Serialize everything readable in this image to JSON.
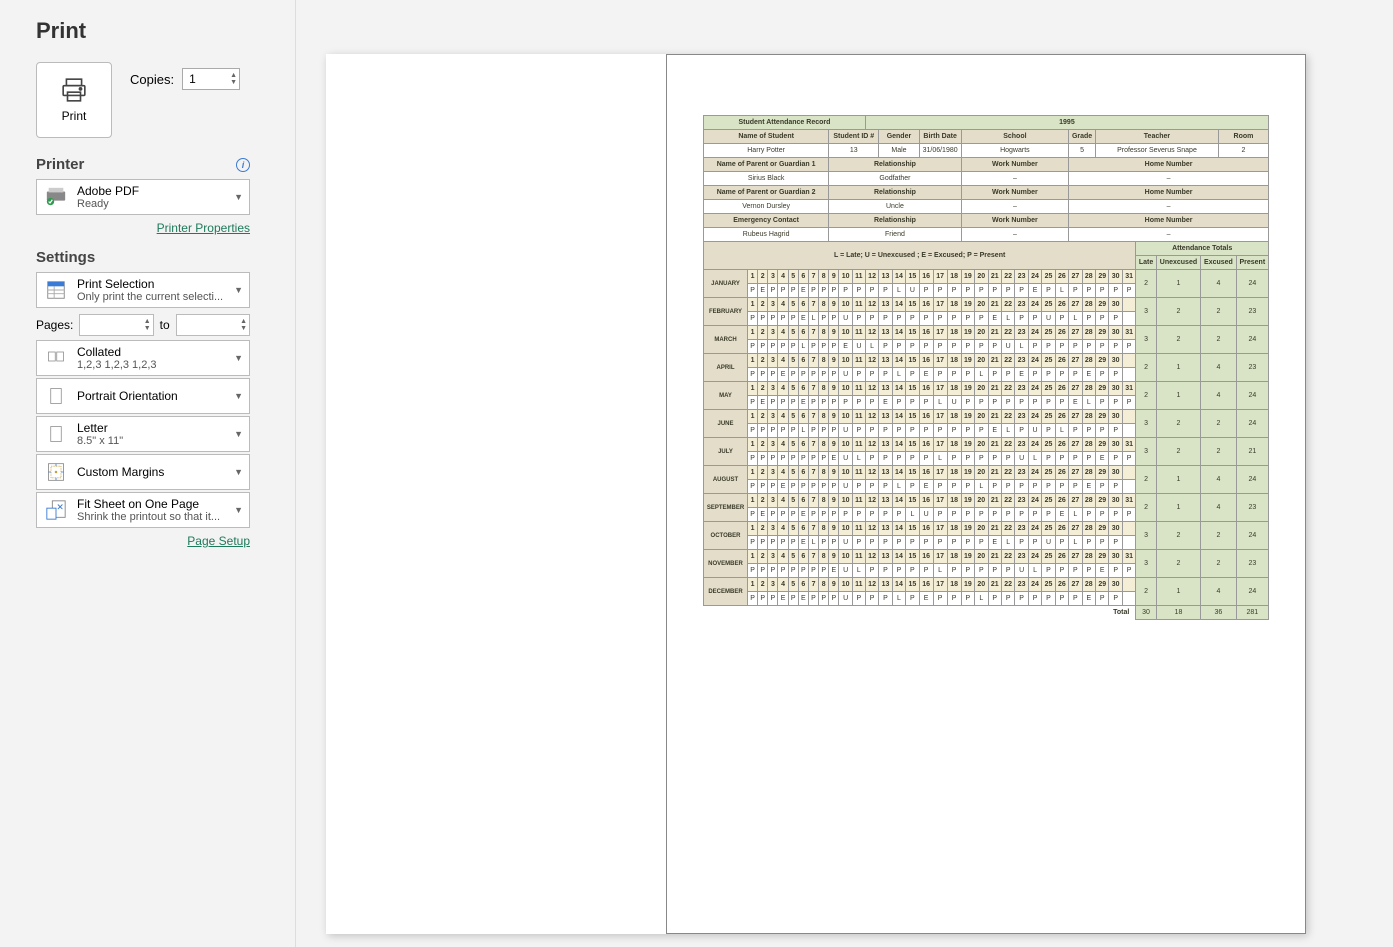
{
  "panel": {
    "title": "Print",
    "print_btn": "Print",
    "copies_label": "Copies:",
    "copies_value": "1",
    "printer_head": "Printer",
    "printer_name": "Adobe PDF",
    "printer_status": "Ready",
    "printer_props": "Printer Properties",
    "settings_head": "Settings",
    "scope_l1": "Print Selection",
    "scope_l2": "Only print the current selecti...",
    "pages_label": "Pages:",
    "to_label": "to",
    "collate_l1": "Collated",
    "collate_l2": "1,2,3    1,2,3    1,2,3",
    "orient": "Portrait Orientation",
    "paper_l1": "Letter",
    "paper_l2": "8.5\" x 11\"",
    "margins": "Custom Margins",
    "fit_l1": "Fit Sheet on One Page",
    "fit_l2": "Shrink the printout so that it...",
    "page_setup": "Page Setup"
  },
  "doc": {
    "title": "Student Attendance Record",
    "year": "1995",
    "cols": {
      "name": "Name of Student",
      "id": "Student ID #",
      "gender": "Gender",
      "birth": "Birth Date",
      "school": "School",
      "grade": "Grade",
      "teacher": "Teacher",
      "room": "Room"
    },
    "student": {
      "name": "Harry Potter",
      "id": "13",
      "gender": "Male",
      "birth": "31/06/1980",
      "school": "Hogwarts",
      "grade": "5",
      "teacher": "Professor Severus Snape",
      "room": "2"
    },
    "guard_labels": {
      "g1": "Name of Parent or Guardian 1",
      "g2": "Name of Parent or Guardian 2",
      "ec": "Emergency Contact",
      "rel": "Relationship",
      "work": "Work Number",
      "home": "Home Number"
    },
    "guardians": [
      {
        "name": "Sirius Black",
        "rel": "Godfather",
        "work": "–",
        "home": "–"
      },
      {
        "name": "Vernon Dursley",
        "rel": "Uncle",
        "work": "–",
        "home": "–"
      },
      {
        "name": "Rubeus Hagrid",
        "rel": "Friend",
        "work": "–",
        "home": "–"
      }
    ],
    "legend": "L = Late; U = Unexcused ; E = Excused; P = Present",
    "totals_head": "Attendance Totals",
    "tot_cols": {
      "late": "Late",
      "unex": "Unexcused",
      "exc": "Excused",
      "pres": "Present"
    },
    "grand_label": "Total",
    "grand": {
      "late": "30",
      "unex": "18",
      "exc": "36",
      "pres": "281"
    },
    "months": [
      {
        "m": "JANUARY",
        "days": 31,
        "vals": [
          "P",
          "E",
          "P",
          "P",
          "P",
          "E",
          "P",
          "P",
          "P",
          "P",
          "P",
          "P",
          "P",
          "L",
          "U",
          "P",
          "P",
          "P",
          "P",
          "P",
          "P",
          "P",
          "P",
          "E",
          "P",
          "L",
          "P",
          "P",
          "P",
          "P",
          "P"
        ],
        "t": [
          "2",
          "1",
          "4",
          "24"
        ]
      },
      {
        "m": "FEBRUARY",
        "days": 30,
        "vals": [
          "P",
          "P",
          "P",
          "P",
          "P",
          "E",
          "L",
          "P",
          "P",
          "U",
          "P",
          "P",
          "P",
          "P",
          "P",
          "P",
          "P",
          "P",
          "P",
          "P",
          "E",
          "L",
          "P",
          "P",
          "U",
          "P",
          "L",
          "P",
          "P",
          "P"
        ],
        "t": [
          "3",
          "2",
          "2",
          "23"
        ]
      },
      {
        "m": "MARCH",
        "days": 31,
        "vals": [
          "P",
          "P",
          "P",
          "P",
          "P",
          "L",
          "P",
          "P",
          "P",
          "E",
          "U",
          "L",
          "P",
          "P",
          "P",
          "P",
          "P",
          "P",
          "P",
          "P",
          "P",
          "U",
          "L",
          "P",
          "P",
          "P",
          "P",
          "P",
          "P",
          "P",
          "P"
        ],
        "t": [
          "3",
          "2",
          "2",
          "24"
        ]
      },
      {
        "m": "APRIL",
        "days": 30,
        "vals": [
          "P",
          "P",
          "P",
          "E",
          "P",
          "P",
          "P",
          "P",
          "P",
          "U",
          "P",
          "P",
          "P",
          "L",
          "P",
          "E",
          "P",
          "P",
          "P",
          "L",
          "P",
          "P",
          "E",
          "P",
          "P",
          "P",
          "P",
          "E",
          "P",
          "P"
        ],
        "t": [
          "2",
          "1",
          "4",
          "23"
        ]
      },
      {
        "m": "MAY",
        "days": 31,
        "vals": [
          "P",
          "E",
          "P",
          "P",
          "P",
          "E",
          "P",
          "P",
          "P",
          "P",
          "P",
          "P",
          "E",
          "P",
          "P",
          "P",
          "L",
          "U",
          "P",
          "P",
          "P",
          "P",
          "P",
          "P",
          "P",
          "P",
          "E",
          "L",
          "P",
          "P",
          "P"
        ],
        "t": [
          "2",
          "1",
          "4",
          "24"
        ]
      },
      {
        "m": "JUNE",
        "days": 30,
        "vals": [
          "P",
          "P",
          "P",
          "P",
          "P",
          "L",
          "P",
          "P",
          "P",
          "U",
          "P",
          "P",
          "P",
          "P",
          "P",
          "P",
          "P",
          "P",
          "P",
          "P",
          "E",
          "L",
          "P",
          "U",
          "P",
          "L",
          "P",
          "P",
          "P",
          "P"
        ],
        "t": [
          "3",
          "2",
          "2",
          "24"
        ]
      },
      {
        "m": "JULY",
        "days": 31,
        "vals": [
          "P",
          "P",
          "P",
          "P",
          "P",
          "P",
          "P",
          "P",
          "E",
          "U",
          "L",
          "P",
          "P",
          "P",
          "P",
          "P",
          "L",
          "P",
          "P",
          "P",
          "P",
          "P",
          "U",
          "L",
          "P",
          "P",
          "P",
          "P",
          "E",
          "P",
          "P"
        ],
        "t": [
          "3",
          "2",
          "2",
          "21"
        ]
      },
      {
        "m": "AUGUST",
        "days": 30,
        "vals": [
          "P",
          "P",
          "P",
          "E",
          "P",
          "P",
          "P",
          "P",
          "P",
          "U",
          "P",
          "P",
          "P",
          "L",
          "P",
          "E",
          "P",
          "P",
          "P",
          "L",
          "P",
          "P",
          "P",
          "P",
          "P",
          "P",
          "P",
          "E",
          "P",
          "P"
        ],
        "t": [
          "2",
          "1",
          "4",
          "24"
        ]
      },
      {
        "m": "SEPTEMBER",
        "days": 31,
        "vals": [
          "P",
          "E",
          "P",
          "P",
          "P",
          "E",
          "P",
          "P",
          "P",
          "P",
          "P",
          "P",
          "P",
          "P",
          "L",
          "U",
          "P",
          "P",
          "P",
          "P",
          "P",
          "P",
          "P",
          "P",
          "P",
          "E",
          "L",
          "P",
          "P",
          "P",
          "P"
        ],
        "t": [
          "2",
          "1",
          "4",
          "23"
        ]
      },
      {
        "m": "OCTOBER",
        "days": 30,
        "vals": [
          "P",
          "P",
          "P",
          "P",
          "P",
          "E",
          "L",
          "P",
          "P",
          "U",
          "P",
          "P",
          "P",
          "P",
          "P",
          "P",
          "P",
          "P",
          "P",
          "P",
          "E",
          "L",
          "P",
          "P",
          "U",
          "P",
          "L",
          "P",
          "P",
          "P"
        ],
        "t": [
          "3",
          "2",
          "2",
          "24"
        ]
      },
      {
        "m": "NOVEMBER",
        "days": 31,
        "vals": [
          "P",
          "P",
          "P",
          "P",
          "P",
          "P",
          "P",
          "P",
          "E",
          "U",
          "L",
          "P",
          "P",
          "P",
          "P",
          "P",
          "L",
          "P",
          "P",
          "P",
          "P",
          "P",
          "U",
          "L",
          "P",
          "P",
          "P",
          "P",
          "E",
          "P",
          "P"
        ],
        "t": [
          "3",
          "2",
          "2",
          "23"
        ]
      },
      {
        "m": "DECEMBER",
        "days": 30,
        "vals": [
          "P",
          "P",
          "P",
          "E",
          "P",
          "E",
          "P",
          "P",
          "P",
          "U",
          "P",
          "P",
          "P",
          "L",
          "P",
          "E",
          "P",
          "P",
          "P",
          "L",
          "P",
          "P",
          "P",
          "P",
          "P",
          "P",
          "P",
          "E",
          "P",
          "P"
        ],
        "t": [
          "2",
          "1",
          "4",
          "24"
        ]
      }
    ]
  }
}
